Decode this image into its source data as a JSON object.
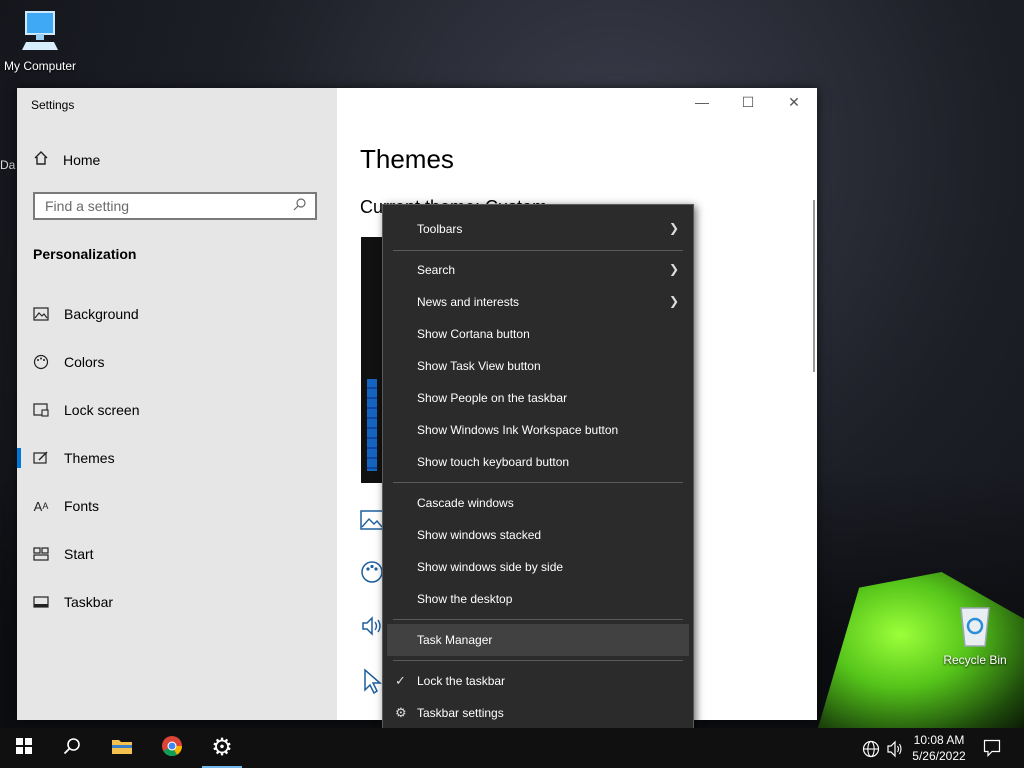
{
  "desktop": {
    "my_computer": "My Computer",
    "recycle_bin": "Recycle Bin",
    "clipped_label": "Da"
  },
  "window": {
    "title": "Settings",
    "controls": {
      "minimize": "—",
      "maximize": "☐",
      "close": "✕"
    }
  },
  "sidebar": {
    "home": "Home",
    "search_placeholder": "Find a setting",
    "section": "Personalization",
    "items": [
      {
        "label": "Background",
        "icon": "image-icon"
      },
      {
        "label": "Colors",
        "icon": "palette-icon"
      },
      {
        "label": "Lock screen",
        "icon": "lock-screen-icon"
      },
      {
        "label": "Themes",
        "icon": "themes-icon",
        "active": true
      },
      {
        "label": "Fonts",
        "icon": "fonts-icon"
      },
      {
        "label": "Start",
        "icon": "start-icon"
      },
      {
        "label": "Taskbar",
        "icon": "taskbar-icon"
      }
    ]
  },
  "main": {
    "heading": "Themes",
    "current_theme": "Current theme: Custom"
  },
  "context_menu": {
    "items": [
      {
        "label": "Toolbars",
        "submenu": true
      },
      {
        "label": "Search",
        "submenu": true
      },
      {
        "label": "News and interests",
        "submenu": true
      },
      {
        "label": "Show Cortana button"
      },
      {
        "label": "Show Task View button"
      },
      {
        "label": "Show People on the taskbar"
      },
      {
        "label": "Show Windows Ink Workspace button"
      },
      {
        "label": "Show touch keyboard button"
      },
      {
        "label": "Cascade windows"
      },
      {
        "label": "Show windows stacked"
      },
      {
        "label": "Show windows side by side"
      },
      {
        "label": "Show the desktop"
      },
      {
        "label": "Task Manager",
        "highlighted": true
      },
      {
        "label": "Lock the taskbar",
        "checked": true
      },
      {
        "label": "Taskbar settings",
        "icon": "gear-icon"
      }
    ]
  },
  "taskbar": {
    "time": "10:08 AM",
    "date": "5/26/2022",
    "accent": "#76b9ed"
  }
}
